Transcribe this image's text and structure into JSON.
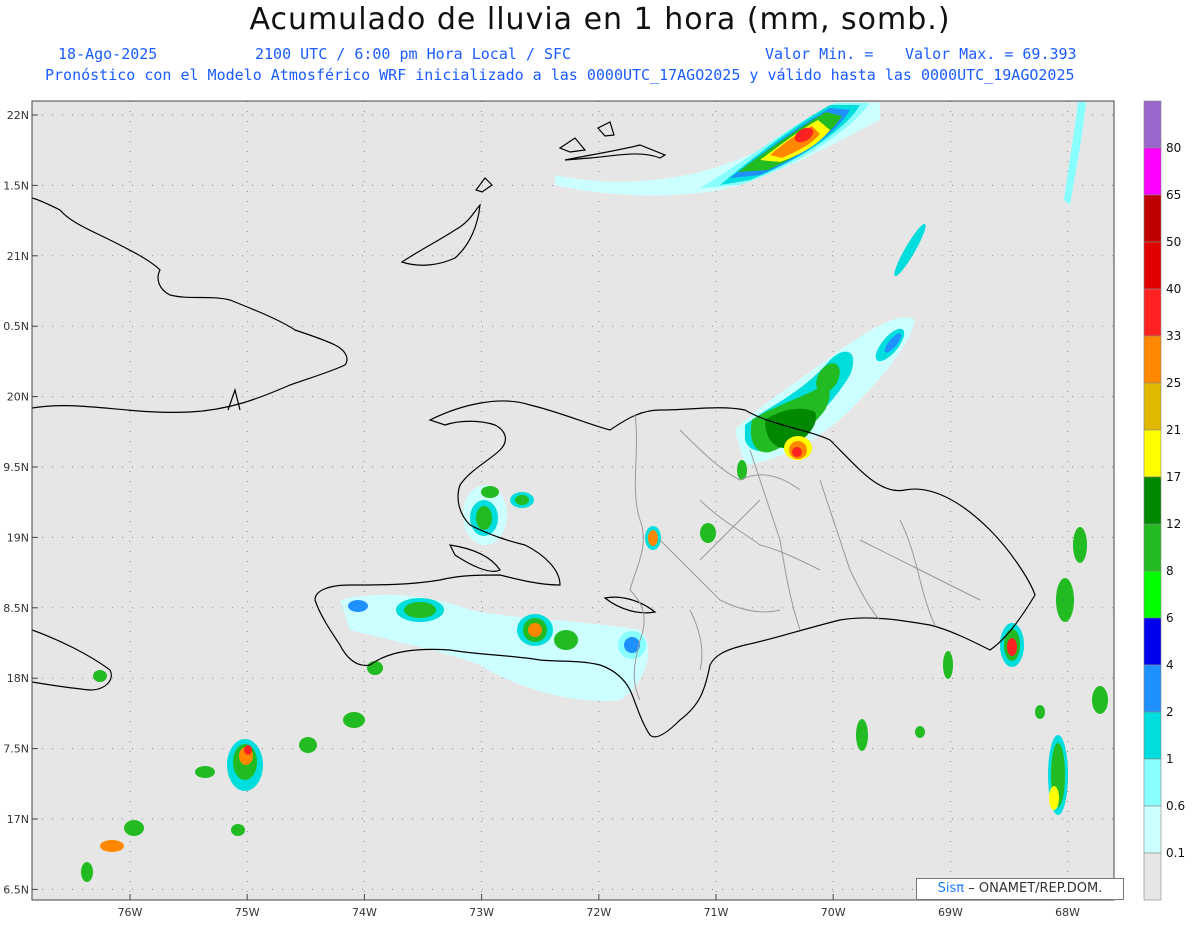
{
  "header": {
    "title": "Acumulado de lluvia en 1 hora (mm, somb.)",
    "date": "18-Ago-2025",
    "time": "2100 UTC / 6:00 pm Hora Local / SFC",
    "valor_min": "Valor Min. =",
    "valor_max": "Valor Max. = 69.393",
    "model_line": "Pronóstico con el Modelo Atmosférico WRF inicializado a las 0000UTC_17AGO2025 y válido hasta las 0000UTC_19AGO2025"
  },
  "map": {
    "lat_labels": [
      "22N",
      "1.5N",
      "21N",
      "0.5N",
      "20N",
      "9.5N",
      "19N",
      "8.5N",
      "18N",
      "7.5N",
      "17N",
      "6.5N"
    ],
    "lon_labels": [
      "76W",
      "75W",
      "74W",
      "73W",
      "72W",
      "71W",
      "70W",
      "69W",
      "68W"
    ]
  },
  "legend": {
    "labels": [
      "80",
      "65",
      "50",
      "40",
      "33",
      "25",
      "21",
      "17",
      "12",
      "8",
      "6",
      "4",
      "2",
      "1",
      "0.6",
      "0.1"
    ],
    "colors": [
      "#9966cc",
      "#ff00ff",
      "#c00000",
      "#e00000",
      "#ff2222",
      "#ff8800",
      "#e0b800",
      "#ffff00",
      "#008800",
      "#22bb22",
      "#00ff00",
      "#0000ee",
      "#1e90ff",
      "#00dddd",
      "#88ffff",
      "#ccffff",
      "#e6e6e6"
    ]
  },
  "credit": {
    "logo": "Sisπ",
    "text": "– ONAMET/REP.DOM."
  },
  "colors": {
    "background": "#e6e6e6",
    "title_blue": "#1a5cff",
    "coast": "#000000",
    "province_border": "#999999"
  }
}
